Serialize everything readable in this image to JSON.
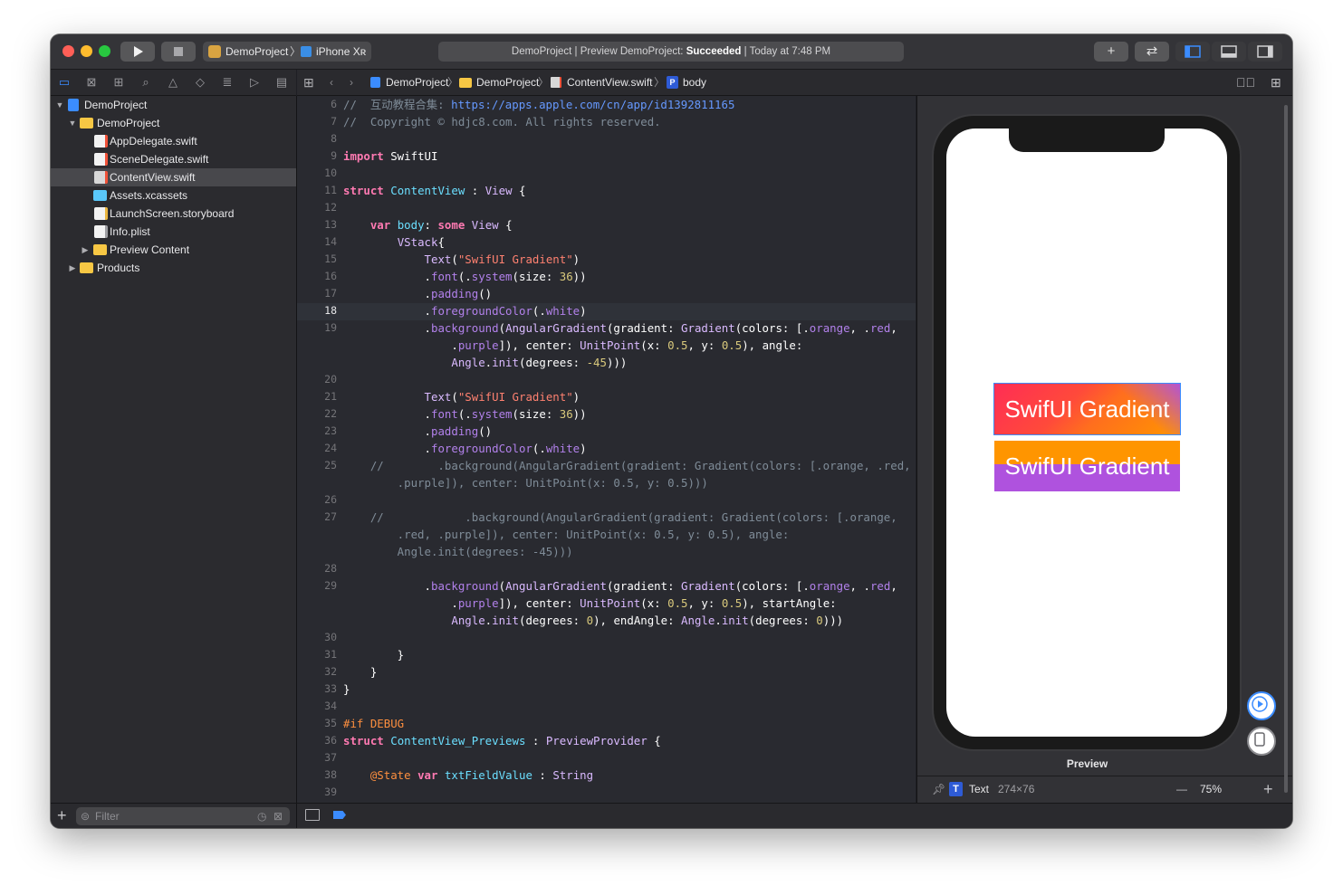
{
  "window": {
    "scheme_project": "DemoProject",
    "scheme_device": "iPhone Xʀ",
    "status": {
      "prefix": "DemoProject | Preview DemoProject: ",
      "result": "Succeeded",
      "suffix": " | Today at 7:48 PM"
    },
    "library_icon": "plus",
    "review_icon": "swap-arrows",
    "colors": {
      "accent": "#3b8cff",
      "background": "#1f1f24",
      "success": "#ffffff"
    }
  },
  "navigator": {
    "items": [
      {
        "label": "DemoProject",
        "icon": "project-icon"
      },
      {
        "label": "DemoProject",
        "icon": "folder-icon"
      },
      {
        "label": "AppDelegate.swift",
        "icon": "swift-file-icon"
      },
      {
        "label": "SceneDelegate.swift",
        "icon": "swift-file-icon"
      },
      {
        "label": "ContentView.swift",
        "icon": "swift-file-icon",
        "selected": true
      },
      {
        "label": "Assets.xcassets",
        "icon": "assets-folder-icon"
      },
      {
        "label": "LaunchScreen.storyboard",
        "icon": "storyboard-icon"
      },
      {
        "label": "Info.plist",
        "icon": "plist-icon"
      },
      {
        "label": "Preview Content",
        "icon": "folder-icon"
      },
      {
        "label": "Products",
        "icon": "folder-icon"
      }
    ],
    "filter_placeholder": "Filter"
  },
  "jumpbar": {
    "crumbs": [
      "DemoProject",
      "DemoProject",
      "ContentView.swift",
      "body"
    ],
    "symbol_badge": "P"
  },
  "editor": {
    "current_line": 18,
    "line_numbers": [
      "6",
      "7",
      "8",
      "9",
      "10",
      "11",
      "12",
      "13",
      "14",
      "15",
      "16",
      "17",
      "18",
      "19",
      "",
      "",
      "20",
      "21",
      "22",
      "23",
      "24",
      "25",
      "",
      "26",
      "27",
      "",
      "",
      "28",
      "29",
      "",
      "",
      "30",
      "31",
      "32",
      "33",
      "34",
      "35",
      "36",
      "37",
      "38",
      "39"
    ]
  },
  "preview": {
    "gradient_text_1": "SwifUI Gradient",
    "gradient_text_2": "SwifUI Gradient",
    "label": "Preview",
    "status_badge": "T",
    "status_type": "Text",
    "status_size": "274×76",
    "zoom": "75%"
  }
}
